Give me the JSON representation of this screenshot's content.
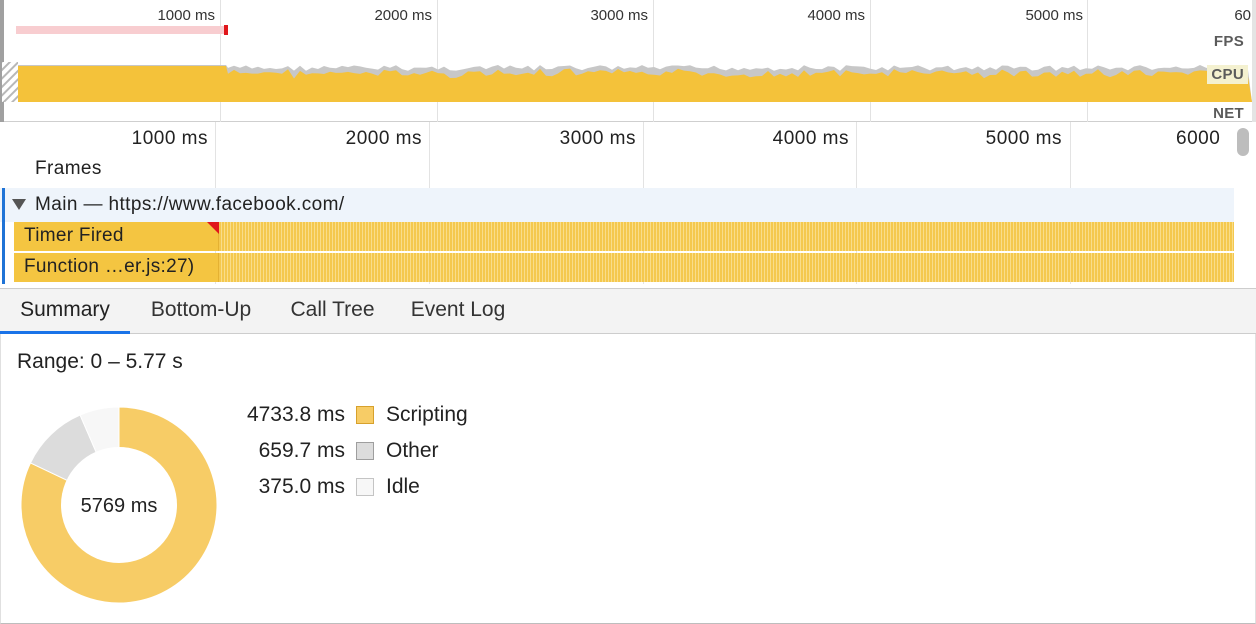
{
  "overview": {
    "ticks": [
      "1000 ms",
      "2000 ms",
      "3000 ms",
      "4000 ms",
      "5000 ms",
      "60"
    ],
    "labels": {
      "fps": "FPS",
      "cpu": "CPU",
      "net": "NET"
    }
  },
  "flame": {
    "ticks": [
      "1000 ms",
      "2000 ms",
      "3000 ms",
      "4000 ms",
      "5000 ms",
      "6000"
    ],
    "frames_label": "Frames",
    "main_label": "Main — https://www.facebook.com/",
    "rows": [
      {
        "label": "Timer Fired"
      },
      {
        "label": "Function …er.js:27)"
      }
    ]
  },
  "tabs": [
    {
      "label": "Summary",
      "active": true
    },
    {
      "label": "Bottom-Up",
      "active": false
    },
    {
      "label": "Call Tree",
      "active": false
    },
    {
      "label": "Event Log",
      "active": false
    }
  ],
  "summary": {
    "range": "Range: 0 – 5.77 s",
    "total": "5769 ms",
    "items": [
      {
        "value": "4733.8 ms",
        "name": "Scripting",
        "color": "#f7cc66",
        "border": "#d7a12c",
        "ms": 4733.8
      },
      {
        "value": "659.7 ms",
        "name": "Other",
        "color": "#dcdcdc",
        "border": "#9e9e9e",
        "ms": 659.7
      },
      {
        "value": "375.0 ms",
        "name": "Idle",
        "color": "#f7f7f7",
        "border": "#c4c4c4",
        "ms": 375.0
      }
    ]
  },
  "colors": {
    "scripting_fill": "#f4c23a",
    "accent_blue": "#1a73e8",
    "frame_marker_red": "#e0161b"
  }
}
